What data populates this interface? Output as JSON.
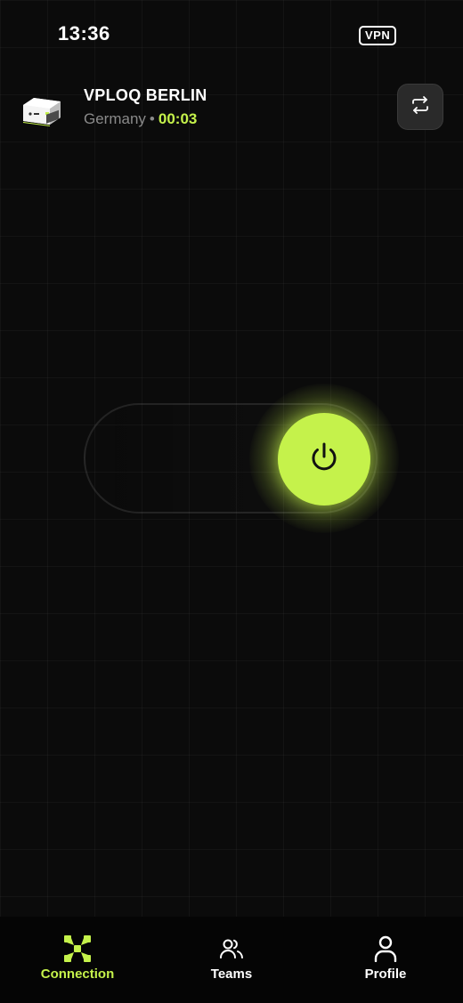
{
  "status_bar": {
    "time": "13:36",
    "vpn_badge": "VPN"
  },
  "server": {
    "name": "VPLOQ BERLIN",
    "country": "Germany",
    "separator": "•",
    "timer": "00:03",
    "icon": "server-box-icon",
    "switch_icon": "swap-arrows-icon"
  },
  "connection": {
    "state": "connected",
    "power_icon": "power-icon"
  },
  "nav": {
    "items": [
      {
        "label": "Connection",
        "icon": "connection-icon",
        "active": true
      },
      {
        "label": "Teams",
        "icon": "teams-icon",
        "active": false
      },
      {
        "label": "Profile",
        "icon": "profile-icon",
        "active": false
      }
    ]
  },
  "colors": {
    "accent": "#c5f24b",
    "background": "#0b0b0b",
    "muted_text": "#8a8a8a",
    "button_bg": "#2a2a2a"
  }
}
